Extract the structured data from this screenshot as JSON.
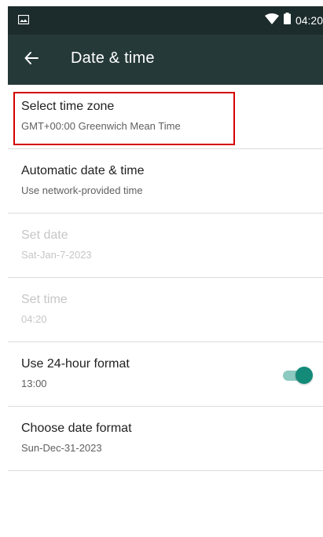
{
  "status_bar": {
    "time": "04:20",
    "left_icon": "image-icon",
    "wifi_icon": "wifi-icon",
    "battery_icon": "battery-icon"
  },
  "toolbar": {
    "title": "Date & time",
    "back_icon": "back-arrow-icon"
  },
  "settings": [
    {
      "title": "Select time zone",
      "summary": "GMT+00:00 Greenwich Mean Time",
      "enabled": true,
      "highlighted": true
    },
    {
      "title": "Automatic date & time",
      "summary": "Use network-provided time",
      "enabled": true
    },
    {
      "title": "Set date",
      "summary": "Sat-Jan-7-2023",
      "enabled": false
    },
    {
      "title": "Set time",
      "summary": "04:20",
      "enabled": false
    },
    {
      "title": "Use 24-hour format",
      "summary": "13:00",
      "enabled": true,
      "toggle_on": true
    },
    {
      "title": "Choose date format",
      "summary": "Sun-Dec-31-2023",
      "enabled": true
    }
  ],
  "colors": {
    "status_bar": "#1c2b2b",
    "toolbar": "#263939",
    "accent": "#148a79",
    "highlight": "#d40000"
  }
}
